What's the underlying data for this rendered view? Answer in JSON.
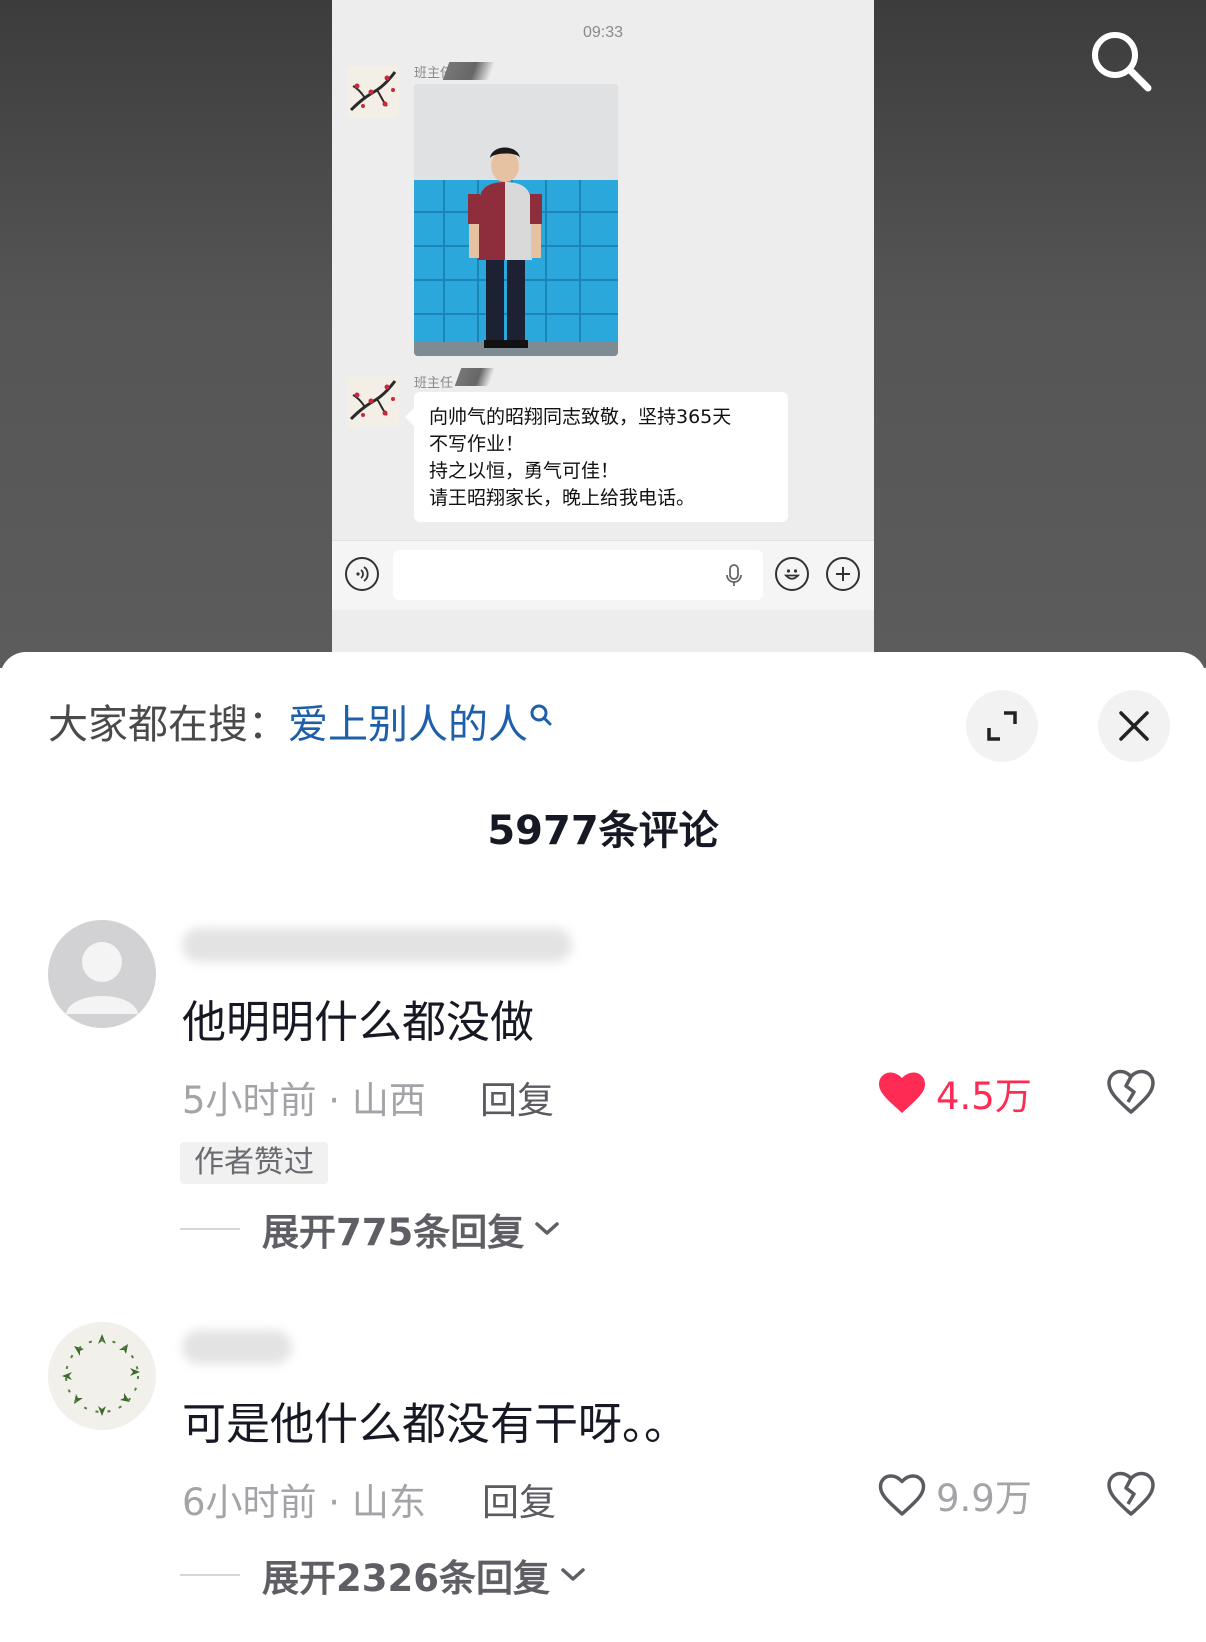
{
  "chat": {
    "time": "09:33",
    "sender_name": "班主任",
    "message_lines": [
      "向帅气的昭翔同志致敬，坚持365天",
      "不写作业！",
      "持之以恒，勇气可佳！",
      "请王昭翔家长，晚上给我电话。"
    ]
  },
  "sheet": {
    "hot_search_prefix": "大家都在搜：",
    "hot_search_term": "爱上别人的人",
    "comment_count": "5977条评论"
  },
  "comments": [
    {
      "text": "他明明什么都没做",
      "time": "5小时前",
      "location": "山西",
      "reply_label": "回复",
      "likes": "4.5万",
      "liked": true,
      "badge": "作者赞过",
      "expand_label": "展开775条回复"
    },
    {
      "text": "可是他什么都没有干呀。。",
      "time": "6小时前",
      "location": "山东",
      "reply_label": "回复",
      "likes": "9.9万",
      "liked": false,
      "expand_label": "展开2326条回复"
    }
  ],
  "colors": {
    "like_red": "#fe2c55",
    "link_blue": "#1e5fa8",
    "meta_gray": "#a3a3a8"
  },
  "icons": [
    "search-icon",
    "expand-icon",
    "close-icon",
    "voice-icon",
    "mic-icon",
    "emoji-icon",
    "plus-icon",
    "heart-icon",
    "broken-heart-icon",
    "chevron-down-icon"
  ]
}
